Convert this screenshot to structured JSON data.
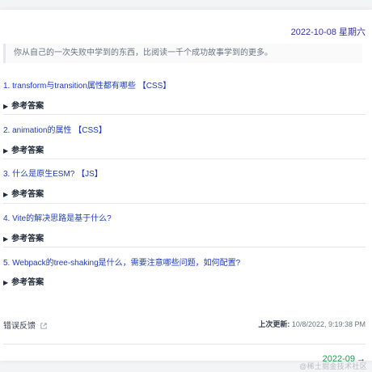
{
  "header": {
    "date": "2022-10-08 星期六"
  },
  "quote": "你从自己的一次失败中学到的东西，比阅读一千个成功故事学到的更多。",
  "questions": [
    {
      "title": "1. transform与transition属性都有哪些 【CSS】",
      "answer_label": "参考答案"
    },
    {
      "title": "2. animation的属性 【CSS】",
      "answer_label": "参考答案"
    },
    {
      "title": "3. 什么是原生ESM? 【JS】",
      "answer_label": "参考答案"
    },
    {
      "title": "4. Vite的解决思路是基于什么?",
      "answer_label": "参考答案"
    },
    {
      "title": "5. Webpack的tree-shaking是什么，需要注意哪些问题，如何配置?",
      "answer_label": "参考答案"
    }
  ],
  "footer": {
    "feedback_label": "错误反馈",
    "updated_label": "上次更新:",
    "updated_value": "10/8/2022, 9:19:38 PM",
    "next_label": "2022-09",
    "next_arrow": "→"
  },
  "watermark": "@稀土掘金技术社区",
  "colors": {
    "link": "#1d39c4",
    "date": "#3730a3",
    "next": "#16a34a"
  }
}
